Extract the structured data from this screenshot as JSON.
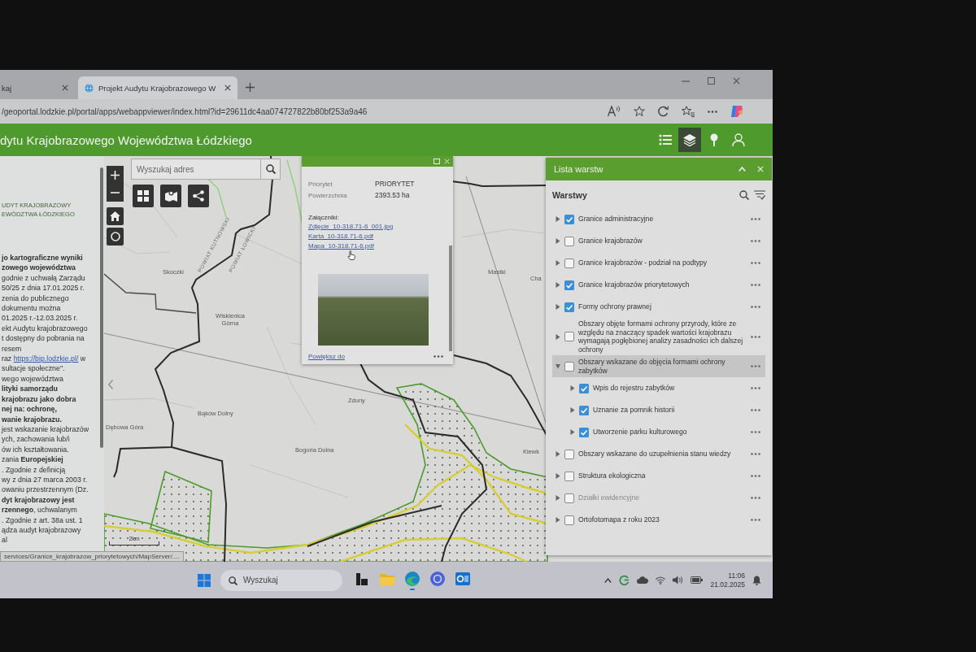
{
  "browser": {
    "tabs": [
      {
        "title": "kaj",
        "selected": false
      },
      {
        "title": "Projekt Audytu Krajobrazowego W",
        "selected": true
      }
    ],
    "address": "/geoportal.lodzkie.pl/portal/apps/webappviewer/index.html?id=29611dc4aa074727822b80bf253a9a46"
  },
  "app": {
    "title": "dytu Krajobrazowego Województwa Łódzkiego",
    "widgets": [
      {
        "kind": "legend",
        "selected": false
      },
      {
        "kind": "layers",
        "selected": true
      },
      {
        "kind": "pin",
        "selected": false
      },
      {
        "kind": "person",
        "selected": false
      }
    ]
  },
  "side_panel": {
    "heading": [
      "UDYT KRAJOBRAZOWY",
      "EWÓDZTWA ŁÓDZKIEGO"
    ],
    "lines": [
      {
        "kind": "text",
        "text": "jo kartograficzne wyniki",
        "bold": true
      },
      {
        "kind": "text",
        "text": "zowego województwa",
        "bold": true
      },
      {
        "kind": "text",
        "text": "godnie z uchwałą Zarządu",
        "bold": false
      },
      {
        "kind": "text",
        "text": "50/25 z dnia 17.01.2025 r.",
        "bold": false
      },
      {
        "kind": "text",
        "text": "zenia do publicznego",
        "bold": false
      },
      {
        "kind": "text",
        "text": "dokumentu można",
        "bold": false
      },
      {
        "kind": "text",
        "text": "01.2025 r.-12.03.2025 r.",
        "bold": false
      },
      {
        "kind": "text",
        "text": "ekt Audytu krajobrazowego",
        "bold": false
      },
      {
        "kind": "text",
        "text": "t dostępny do pobrania na",
        "bold": false
      },
      {
        "kind": "text",
        "text": "resem",
        "bold": false
      },
      {
        "kind": "link",
        "before": "raz",
        "link": "https://bip.lodzkie.pl/",
        "after": "w"
      },
      {
        "kind": "text",
        "text": "sultacje społeczne\".",
        "bold": false
      },
      {
        "kind": "text",
        "text": "wego województwa",
        "bold": false
      },
      {
        "kind": "text",
        "text": "lityki samorządu",
        "bold": true
      },
      {
        "kind": "text",
        "text": "krajobrazu jako dobra",
        "bold": true
      },
      {
        "kind": "text",
        "text": "nej na: ochronę,",
        "bold": true
      },
      {
        "kind": "text",
        "text": "wanie krajobrazu.",
        "bold": true
      },
      {
        "kind": "text",
        "text": "jest wskazanie krajobrazów",
        "bold": false
      },
      {
        "kind": "text",
        "text": "ych, zachowania lub/i",
        "bold": false
      },
      {
        "kind": "text",
        "text": "ów ich kształtowania.",
        "bold": false
      },
      {
        "kind": "text",
        "text": "zania **Europejskiej**",
        "bold": false
      },
      {
        "kind": "text",
        "text": ". Zgodnie z definicją",
        "bold": false
      },
      {
        "kind": "text",
        "text": "wy z dnia 27 marca 2003 r.",
        "bold": false
      },
      {
        "kind": "text",
        "text": "owaniu przestrzennym (Dz.",
        "bold": false
      },
      {
        "kind": "text",
        "text": "dyt krajobrazowy jest",
        "bold": true
      },
      {
        "kind": "text",
        "text": "**rzennego**, uchwalanym",
        "bold": false
      },
      {
        "kind": "text",
        "text": ". Zgodnie z art. 38a ust. 1",
        "bold": false
      },
      {
        "kind": "text",
        "text": "ądza audyt krajobrazowy",
        "bold": false
      },
      {
        "kind": "text",
        "text": "al",
        "bold": false
      }
    ]
  },
  "map": {
    "search": {
      "placeholder": "Wyszukaj adres"
    },
    "labels": [
      {
        "text": "Skoczki",
        "kind": "place"
      },
      {
        "text": "POWIAT KUTNOWSKI",
        "kind": "boundary"
      },
      {
        "text": "POWIAT ŁOWICKI",
        "kind": "boundary"
      },
      {
        "text": "Wiskienica Górna",
        "kind": "place"
      },
      {
        "text": "Mastki",
        "kind": "place"
      },
      {
        "text": "Cha",
        "kind": "place"
      },
      {
        "text": "Zduny",
        "kind": "place"
      },
      {
        "text": "Bąków Dolny",
        "kind": "place"
      },
      {
        "text": "Dębowa Góra",
        "kind": "place"
      },
      {
        "text": "Bogoria Dolna",
        "kind": "place"
      },
      {
        "text": "Klewk",
        "kind": "place"
      }
    ],
    "scale": "2km"
  },
  "popup": {
    "fields": [
      {
        "label": "Priorytet",
        "value": "PRIORYTET"
      },
      {
        "label": "Powierzchnia",
        "value": "2393.53 ha"
      }
    ],
    "attachments_label": "Załączniki:",
    "attachments": [
      "Zdjęcie_10-318.71-6_001.jpg",
      "Karta_10-318.71-6.pdf",
      "Mapa_10-318.71-6.pdf"
    ],
    "zoom_link": "Powiększ do"
  },
  "layer_list": {
    "title": "Lista warstw",
    "heading": "Warstwy",
    "layers": [
      {
        "name": "Granice administracyjne",
        "checked": true,
        "expanded": false,
        "disabled": false,
        "selected": false
      },
      {
        "name": "Granice krajobrazów",
        "checked": false,
        "expanded": false,
        "disabled": false,
        "selected": false
      },
      {
        "name": "Granice krajobrazów - podział na podtypy",
        "checked": false,
        "expanded": false,
        "disabled": false,
        "selected": false
      },
      {
        "name": "Granice krajobrazów priorytetowych",
        "checked": true,
        "expanded": false,
        "disabled": false,
        "selected": false
      },
      {
        "name": "Formy ochrony prawnej",
        "checked": true,
        "expanded": false,
        "disabled": false,
        "selected": false
      },
      {
        "name": "Obszary objęte formami ochrony przyrody, które ze względu na znaczący spadek wartości krajobrazu wymagają pogłębionej analizy zasadności ich dalszej ochrony",
        "checked": false,
        "expanded": false,
        "disabled": false,
        "selected": false
      },
      {
        "name": "Obszary wskazane do objęcia formami ochrony zabytków",
        "checked": false,
        "expanded": true,
        "disabled": false,
        "selected": true,
        "children": [
          {
            "name": "Wpis do rejestru zabytków",
            "checked": true,
            "expanded": false,
            "disabled": false,
            "selected": false
          },
          {
            "name": "Uznanie za pomnik historii",
            "checked": true,
            "expanded": false,
            "disabled": false,
            "selected": false
          },
          {
            "name": "Utworzenie parku kulturowego",
            "checked": true,
            "expanded": false,
            "disabled": false,
            "selected": false
          }
        ]
      },
      {
        "name": "Obszary wskazane do uzupełnienia stanu wiedzy",
        "checked": false,
        "expanded": false,
        "disabled": false,
        "selected": false
      },
      {
        "name": "Struktura ekologiczna",
        "checked": false,
        "expanded": false,
        "disabled": false,
        "selected": false
      },
      {
        "name": "Działki ewidencyjne",
        "checked": false,
        "expanded": false,
        "disabled": true,
        "selected": false
      },
      {
        "name": "Ortofotomapa z roku 2023",
        "checked": false,
        "expanded": false,
        "disabled": false,
        "selected": false
      }
    ]
  },
  "status_url": "services/Granice_krajobrazow_priorytetowych/MapServer/....",
  "taskbar": {
    "search": {
      "placeholder": "Wyszukaj"
    },
    "apps": [
      {
        "kind": "task-view",
        "selected": false
      },
      {
        "kind": "folder",
        "selected": false
      },
      {
        "kind": "browser",
        "selected": true
      },
      {
        "kind": "assistant",
        "selected": false
      },
      {
        "kind": "mail",
        "selected": false
      }
    ],
    "time": "11:06",
    "date": "21.02.2025"
  }
}
